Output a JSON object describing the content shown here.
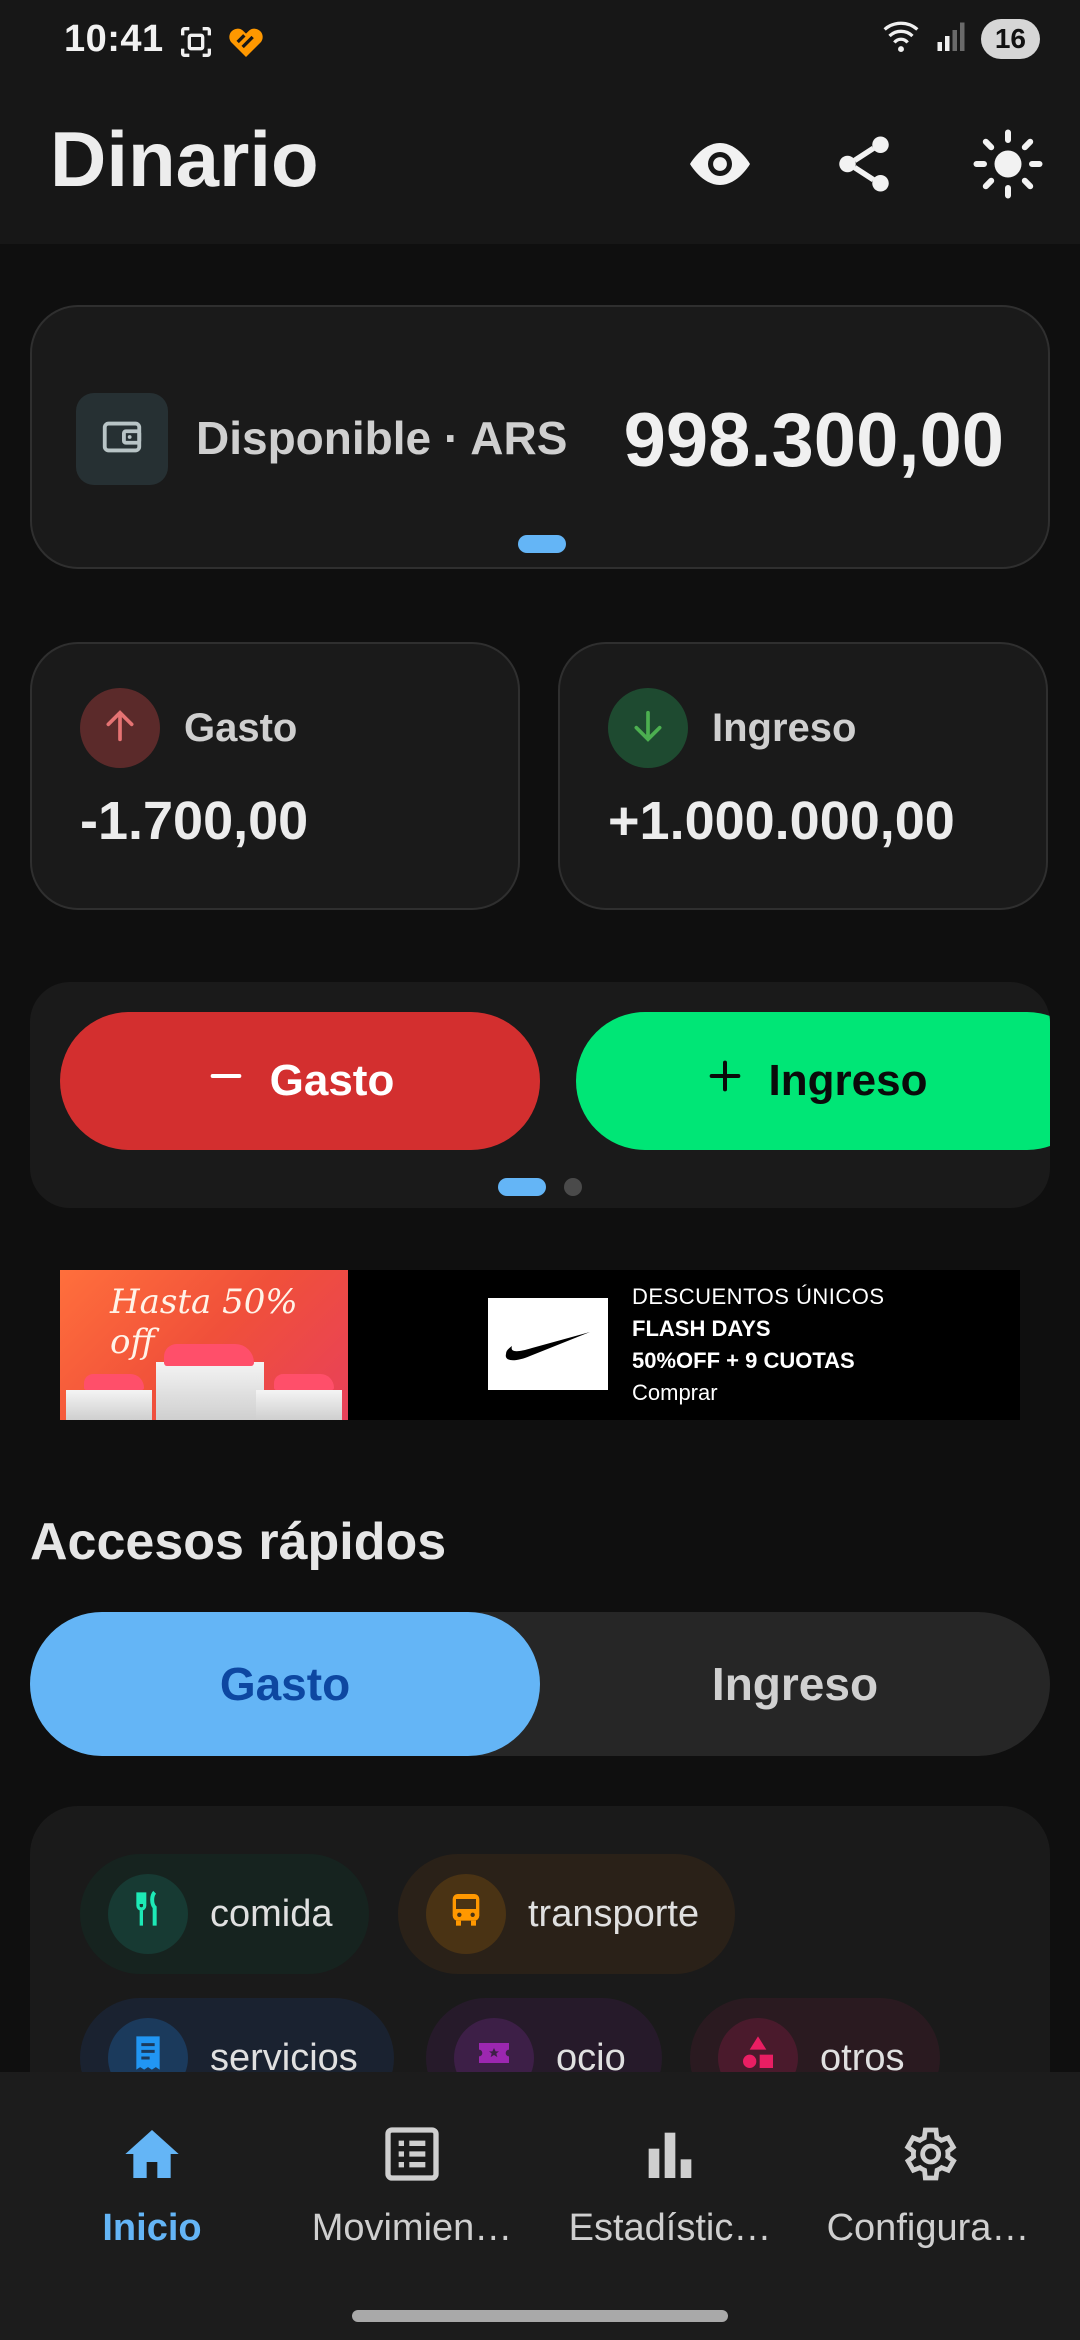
{
  "status_bar": {
    "time": "10:41",
    "battery": "16",
    "icons": [
      "screenshot-icon",
      "heart-app-icon",
      "wifi-icon",
      "signal-icon"
    ]
  },
  "app_bar": {
    "title": "Dinario",
    "actions": [
      "eye-icon",
      "share-icon",
      "brightness-icon"
    ]
  },
  "balance": {
    "label": "Disponible · ARS",
    "amount": "998.300,00",
    "page_indicator": {
      "pages": 1,
      "active": 0
    }
  },
  "stats": {
    "expense": {
      "label": "Gasto",
      "value": "-1.700,00",
      "color": "#e57373"
    },
    "income": {
      "label": "Ingreso",
      "value": "+1.000.000,00",
      "color": "#4caf50"
    }
  },
  "actions": {
    "expense_label": "Gasto",
    "income_label": "Ingreso",
    "expense_color": "#d32f2f",
    "income_color": "#00e676",
    "page_indicator": {
      "pages": 2,
      "active": 0
    }
  },
  "ad": {
    "headline": "Hasta 50% off",
    "line1": "DESCUENTOS ÚNICOS",
    "line2": "FLASH DAYS",
    "line3": "50%OFF + 9 CUOTAS",
    "cta": "Comprar"
  },
  "quick_access": {
    "title": "Accesos rápidos",
    "tabs": [
      {
        "label": "Gasto",
        "selected": true
      },
      {
        "label": "Ingreso",
        "selected": false
      }
    ],
    "chips": [
      {
        "label": "comida",
        "icon": "fork-knife-icon",
        "color": "#1de9b6"
      },
      {
        "label": "transporte",
        "icon": "bus-icon",
        "color": "#ff9800"
      },
      {
        "label": "servicios",
        "icon": "receipt-icon",
        "color": "#2196f3"
      },
      {
        "label": "ocio",
        "icon": "ticket-icon",
        "color": "#9c27b0"
      },
      {
        "label": "otros",
        "icon": "shapes-icon",
        "color": "#e91e63"
      }
    ]
  },
  "bottom_nav": {
    "items": [
      {
        "label": "Inicio",
        "icon": "home-icon",
        "active": true
      },
      {
        "label": "Movimien…",
        "icon": "list-icon",
        "active": false
      },
      {
        "label": "Estadístic…",
        "icon": "bar-chart-icon",
        "active": false
      },
      {
        "label": "Configura…",
        "icon": "gear-icon",
        "active": false
      }
    ]
  },
  "colors": {
    "accent": "#64b5f6",
    "background": "#0f0f0f",
    "card": "#1a1a1a"
  }
}
